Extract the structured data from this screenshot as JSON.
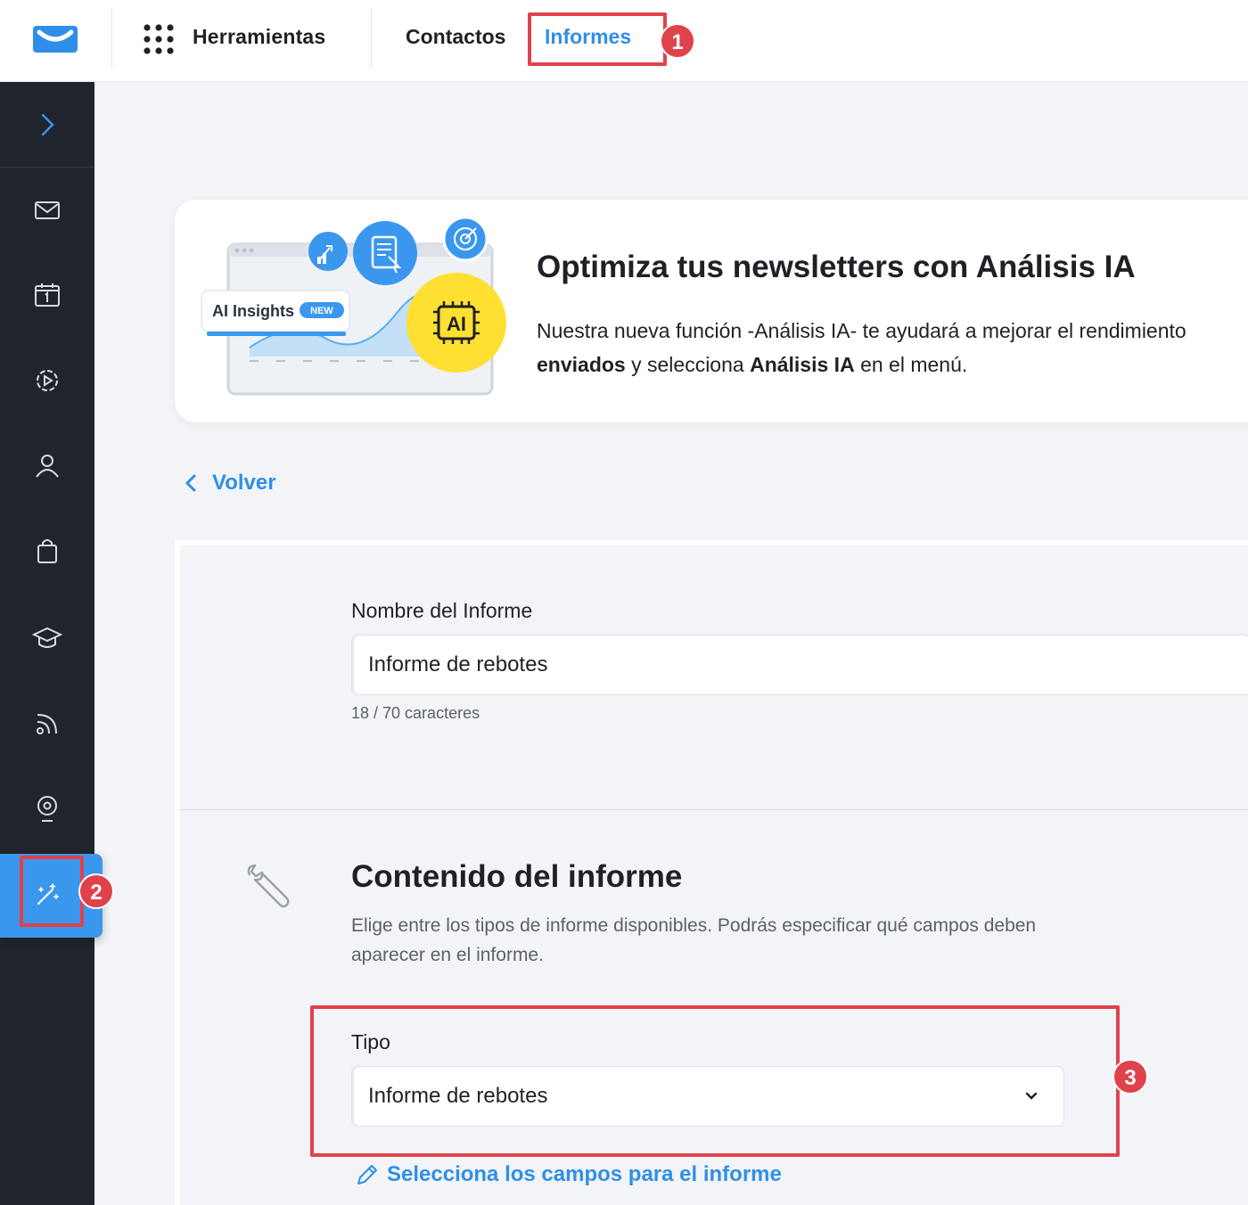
{
  "topbar": {
    "logo_icon": "getresponse-envelope-icon",
    "tools_icon": "grid-dots-icon",
    "tools_label": "Herramientas",
    "nav_contacts": "Contactos",
    "nav_reports": "Informes",
    "accent_color": "#2f8fe8"
  },
  "sidebar": {
    "items": [
      {
        "icon": "chevron-right-icon"
      },
      {
        "icon": "mail-icon"
      },
      {
        "icon": "calendar-icon"
      },
      {
        "icon": "gear-play-icon"
      },
      {
        "icon": "user-icon"
      },
      {
        "icon": "shopping-bag-icon"
      },
      {
        "icon": "graduation-cap-icon"
      },
      {
        "icon": "rss-icon"
      },
      {
        "icon": "webinar-icon"
      },
      {
        "icon": "magic-wand-icon",
        "active": true
      }
    ]
  },
  "banner": {
    "ai_badge": "AI Insights",
    "new_badge": "NEW",
    "ai_chip": "AI",
    "title": "Optimiza tus newsletters con Análisis IA",
    "text_part1": "Nuestra nueva función -Análisis IA- te ayudará a mejorar el rendimiento",
    "text_bold1": "enviados",
    "text_part2": " y selecciona ",
    "text_bold2": "Análisis IA",
    "text_part3": " en el menú."
  },
  "back": {
    "label": "Volver"
  },
  "form": {
    "name_label": "Nombre del Informe",
    "name_value": "Informe de rebotes",
    "name_counter": "18 / 70 caracteres",
    "section_title": "Contenido del informe",
    "section_desc": "Elige entre los tipos de informe disponibles. Podrás especificar qué campos deben aparecer en el informe.",
    "type_label": "Tipo",
    "type_value": "Informe de rebotes",
    "fields_link": "Selecciona los campos para el informe"
  },
  "annotations": {
    "n1": "1",
    "n2": "2",
    "n3": "3",
    "color": "#e0424b"
  }
}
